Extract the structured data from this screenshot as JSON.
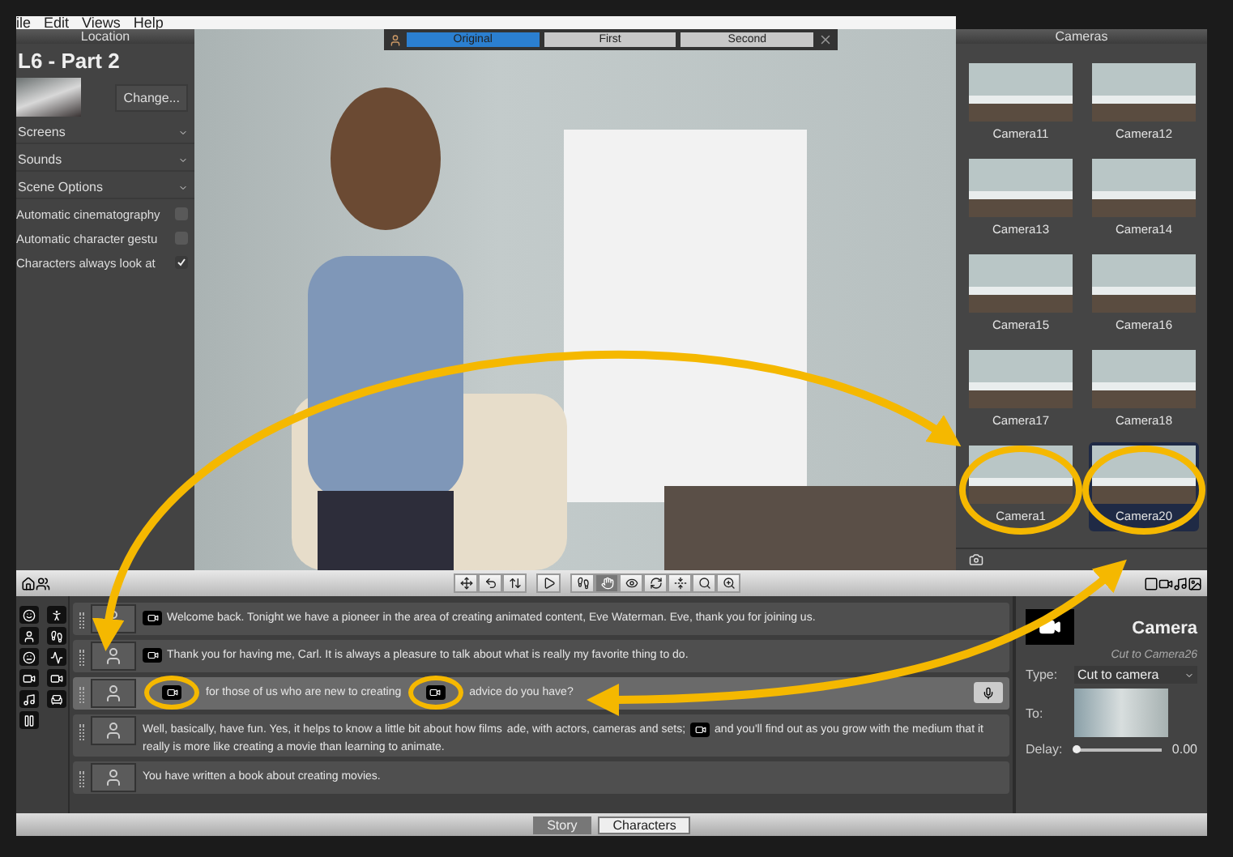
{
  "menu": [
    "ile",
    "Edit",
    "Views",
    "Help"
  ],
  "location": {
    "header": "Location",
    "title": "L6 - Part 2",
    "change_button": "Change...",
    "sections": [
      {
        "label": "Screens"
      },
      {
        "label": "Sounds"
      },
      {
        "label": "Scene Options"
      }
    ],
    "options": [
      {
        "label": "Automatic cinematography",
        "checked": false
      },
      {
        "label": "Automatic character gestu",
        "checked": false
      },
      {
        "label": "Characters always look at",
        "checked": true
      }
    ]
  },
  "view_tabs": [
    {
      "label": "Original",
      "selected": true
    },
    {
      "label": "First",
      "selected": false
    },
    {
      "label": "Second",
      "selected": false
    }
  ],
  "cameras": {
    "header": "Cameras",
    "items": [
      {
        "label": "Camera11",
        "selected": false,
        "highlighted": false
      },
      {
        "label": "Camera12",
        "selected": false,
        "highlighted": false
      },
      {
        "label": "Camera13",
        "selected": false,
        "highlighted": false
      },
      {
        "label": "Camera14",
        "selected": false,
        "highlighted": false
      },
      {
        "label": "Camera15",
        "selected": false,
        "highlighted": false
      },
      {
        "label": "Camera16",
        "selected": false,
        "highlighted": false
      },
      {
        "label": "Camera17",
        "selected": false,
        "highlighted": false
      },
      {
        "label": "Camera18",
        "selected": false,
        "highlighted": false
      },
      {
        "label": "Camera1",
        "selected": false,
        "highlighted": true
      },
      {
        "label": "Camera20",
        "selected": true,
        "highlighted": true
      }
    ]
  },
  "toolbar": {
    "tools": [
      {
        "kind": "move",
        "selected": false
      },
      {
        "kind": "turn",
        "selected": false
      },
      {
        "kind": "updown",
        "selected": false
      },
      {
        "kind": "play",
        "selected": false
      },
      {
        "kind": "walk",
        "selected": false
      },
      {
        "kind": "point",
        "selected": true
      },
      {
        "kind": "look",
        "selected": false
      },
      {
        "kind": "rotate",
        "selected": false
      },
      {
        "kind": "height",
        "selected": false
      },
      {
        "kind": "zoom",
        "selected": false
      },
      {
        "kind": "zoomfit",
        "selected": false
      }
    ]
  },
  "script_rows": [
    {
      "selected": false,
      "segments": [
        {
          "kind": "camera",
          "highlighted": false
        },
        {
          "kind": "text",
          "text": "Welcome back. Tonight we have a pioneer in the area of creating animated content, Eve Waterman. Eve, thank you for joining us."
        }
      ]
    },
    {
      "selected": false,
      "segments": [
        {
          "kind": "camera",
          "highlighted": false
        },
        {
          "kind": "text",
          "text": "Thank you for having me, Carl. It is always a pleasure to talk about what is really my favorite thing to do."
        }
      ]
    },
    {
      "selected": true,
      "segments": [
        {
          "kind": "camera",
          "highlighted": true
        },
        {
          "kind": "text",
          "text": "for those of us who are new to creating"
        },
        {
          "kind": "camera",
          "highlighted": true
        },
        {
          "kind": "text",
          "text": "advice do you have?"
        }
      ]
    },
    {
      "selected": false,
      "segments": [
        {
          "kind": "text",
          "text": "Well, basically, have fun. Yes, it helps to know a little bit about how films"
        },
        {
          "kind": "text",
          "text": "ade, with actors, cameras and sets;"
        },
        {
          "kind": "camera",
          "highlighted": false
        },
        {
          "kind": "text",
          "text": "and you'll find out as you grow with the medium that it"
        },
        {
          "kind": "text",
          "text": "really is more like creating a movie than learning to animate."
        }
      ]
    },
    {
      "selected": false,
      "segments": [
        {
          "kind": "text",
          "text": "You have written a book about creating movies."
        }
      ]
    }
  ],
  "story_tabs": [
    {
      "label": "Story",
      "selected": true
    },
    {
      "label": "Characters",
      "selected": false
    }
  ],
  "properties": {
    "title": "Camera",
    "subtitle": "Cut to Camera26",
    "type_label": "Type:",
    "type_value": "Cut to camera",
    "to_label": "To:",
    "delay_label": "Delay:",
    "delay": {
      "level": 0.02
    },
    "delay_value": "0.00"
  }
}
